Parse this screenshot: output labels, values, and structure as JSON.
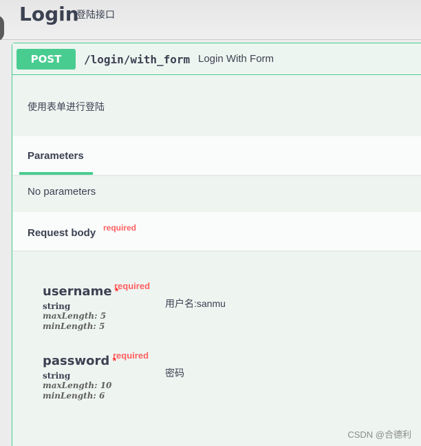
{
  "tag": {
    "title": "Login",
    "description": "登陆接口"
  },
  "operation": {
    "method": "POST",
    "path": "/login/with_form",
    "summary": "Login With Form",
    "description": "使用表单进行登陆",
    "accent_color": "#49cc90"
  },
  "parameters": {
    "tab_label": "Parameters",
    "empty_text": "No parameters"
  },
  "request_body": {
    "title": "Request body",
    "required_label": "required",
    "properties": [
      {
        "name": "username",
        "star": "*",
        "required_label": "required",
        "type": "string",
        "max_length": "maxLength: 5",
        "min_length": "minLength: 5",
        "description": "用户名:sanmu"
      },
      {
        "name": "password",
        "star": "*",
        "required_label": "required",
        "type": "string",
        "max_length": "maxLength: 10",
        "min_length": "minLength: 6",
        "description": "密码"
      }
    ]
  },
  "watermark": "CSDN @合德利"
}
